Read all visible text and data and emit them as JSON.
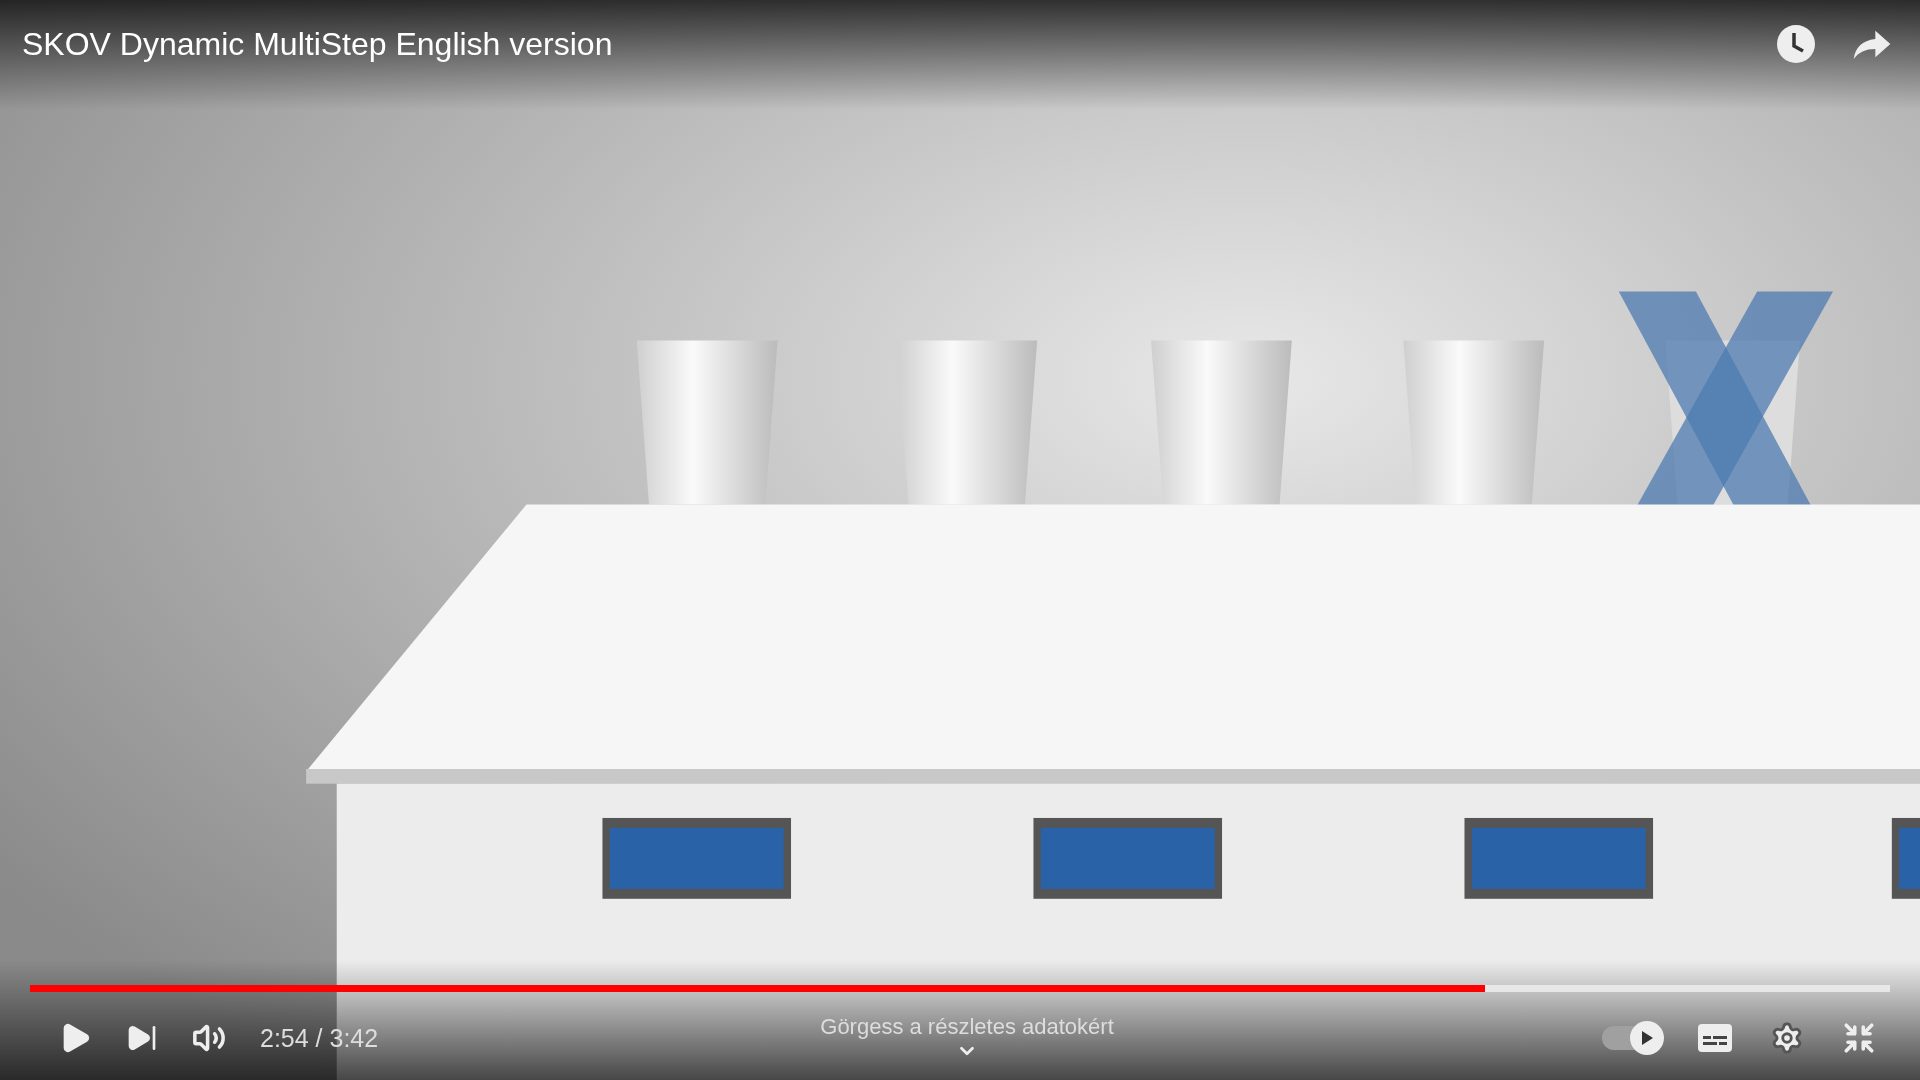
{
  "video": {
    "title": "SKOV Dynamic MultiStep English version"
  },
  "progress": {
    "level": 0.782
  },
  "time": "2:54 / 3:42",
  "scroll_hint": "Görgess a részletes adatokért",
  "autoplay": {
    "on": true
  }
}
